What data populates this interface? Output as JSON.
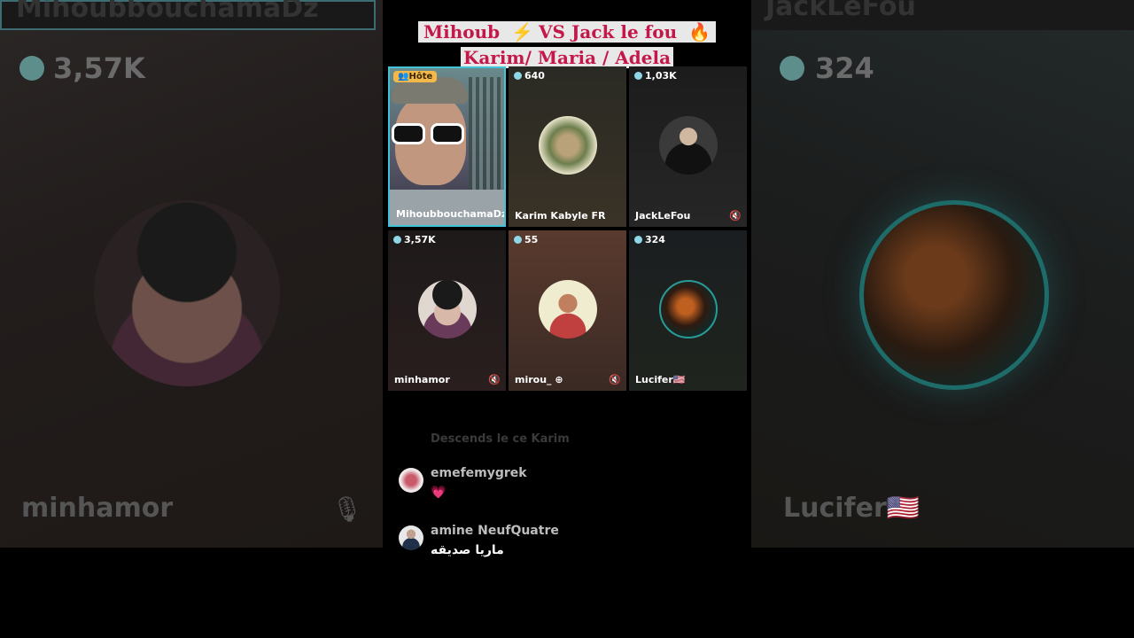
{
  "title": {
    "line1_a": "Mihoub",
    "line1_icon": "⚡",
    "line1_b": "VS Jack le fou",
    "line1_icon2": "🔥",
    "line2": "Karim/ Maria / Adela"
  },
  "side_left": {
    "top_text": "MihoubbouchamaDz",
    "coins": "3,57K",
    "name": "minhamor",
    "mic_icon": "mic-off-icon"
  },
  "side_right": {
    "top_text": "JackLeFou",
    "coins": "324",
    "name": "Lucifer🇺🇸",
    "mic_icon": "none"
  },
  "grid": [
    {
      "host_label": "Hôte",
      "name": "MihoubbouchamaDz",
      "coins": "",
      "muted": false
    },
    {
      "coins": "640",
      "name": "Karim Kabyle FR",
      "muted": false
    },
    {
      "coins": "1,03K",
      "name": "JackLeFou",
      "muted": true
    },
    {
      "coins": "3,57K",
      "name": "minhamor",
      "muted": true
    },
    {
      "coins": "55",
      "name": "mirou_",
      "muted": true,
      "add_icon": "plus-circle-icon"
    },
    {
      "coins": "324",
      "name": "Lucifer🇺🇸",
      "muted": false
    }
  ],
  "chat": {
    "faded_message": "Descends le ce Karim",
    "messages": [
      {
        "user": "emefemygrek",
        "text": "💗"
      },
      {
        "user": "amine NeufQuatre",
        "text": "ماريا صديقه"
      }
    ]
  },
  "colors": {
    "title_text": "#c4184a",
    "title_bg": "#e8e8e8",
    "active_border": "#3fc3d8",
    "host_badge": "#f2b84a"
  }
}
